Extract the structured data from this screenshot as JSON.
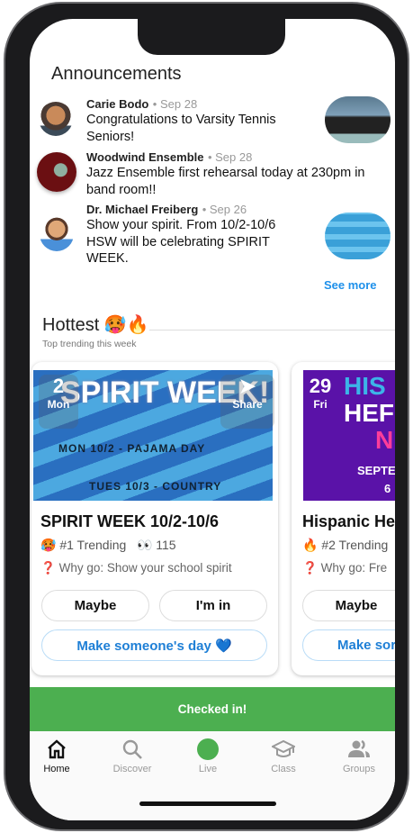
{
  "announcements": {
    "title": "Announcements",
    "items": [
      {
        "author": "Carie Bodo",
        "date": "Sep 28",
        "text": "Congratulations to Varsity Tennis Seniors!"
      },
      {
        "author": "Woodwind Ensemble",
        "date": "Sep 28",
        "text": "Jazz Ensemble first rehearsal today at 230pm in band room!!"
      },
      {
        "author": "Dr. Michael Freiberg",
        "date": "Sep 26",
        "text": "Show your spirit. From 10/2-10/6 HSW will be celebrating SPIRIT WEEK."
      }
    ],
    "see_more": "See more"
  },
  "hottest": {
    "title": "Hottest 🥵🔥",
    "subtitle": "Top trending this week",
    "cards": [
      {
        "day": "2",
        "weekday": "Mon",
        "share": "Share",
        "image_text": "SPIRIT WEEK!",
        "image_line1": "MON 10/2 - PAJAMA DAY",
        "image_line2": "TUES 10/3 - COUNTRY",
        "title": "SPIRIT WEEK 10/2-10/6",
        "trending": "🥵 #1 Trending",
        "views": "👀 115",
        "why": "Why go: Show your school spirit",
        "maybe": "Maybe",
        "in": "I'm in",
        "make_day": "Make someone's day 💙"
      },
      {
        "day": "29",
        "weekday": "Fri",
        "image_text1": "HIS",
        "image_text2": "HEF",
        "image_text3": "N",
        "image_line1": "SEPTE",
        "image_line2": "6",
        "title": "Hispanic He",
        "trending": "🔥 #2 Trending",
        "why": "Why go: Fre",
        "maybe": "Maybe",
        "make_day": "Make sor"
      }
    ]
  },
  "checked_in": "Checked in!",
  "tabs": [
    {
      "label": "Home",
      "icon": "home-icon",
      "active": true
    },
    {
      "label": "Discover",
      "icon": "search-icon"
    },
    {
      "label": "Live",
      "icon": "live-dot-icon"
    },
    {
      "label": "Class",
      "icon": "graduation-cap-icon"
    },
    {
      "label": "Groups",
      "icon": "groups-icon"
    }
  ],
  "colors": {
    "accent": "#1e90ea",
    "success": "#4caf50"
  }
}
